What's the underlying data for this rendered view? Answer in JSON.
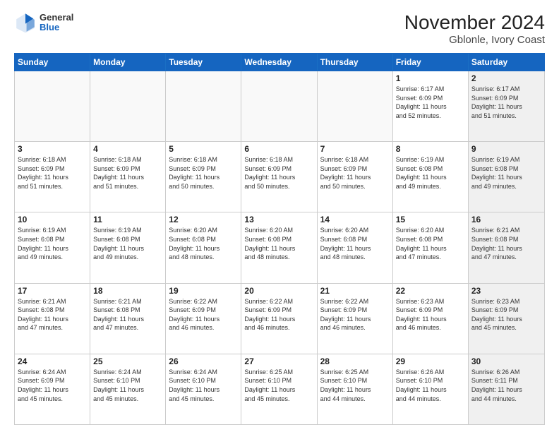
{
  "header": {
    "title": "November 2024",
    "subtitle": "Gblonle, Ivory Coast",
    "logo_general": "General",
    "logo_blue": "Blue"
  },
  "days_of_week": [
    "Sunday",
    "Monday",
    "Tuesday",
    "Wednesday",
    "Thursday",
    "Friday",
    "Saturday"
  ],
  "weeks": [
    [
      {
        "day": "",
        "info": "",
        "shaded": true
      },
      {
        "day": "",
        "info": "",
        "shaded": true
      },
      {
        "day": "",
        "info": "",
        "shaded": true
      },
      {
        "day": "",
        "info": "",
        "shaded": true
      },
      {
        "day": "",
        "info": "",
        "shaded": true
      },
      {
        "day": "1",
        "info": "Sunrise: 6:17 AM\nSunset: 6:09 PM\nDaylight: 11 hours\nand 52 minutes.",
        "shaded": false
      },
      {
        "day": "2",
        "info": "Sunrise: 6:17 AM\nSunset: 6:09 PM\nDaylight: 11 hours\nand 51 minutes.",
        "shaded": true
      }
    ],
    [
      {
        "day": "3",
        "info": "Sunrise: 6:18 AM\nSunset: 6:09 PM\nDaylight: 11 hours\nand 51 minutes.",
        "shaded": false
      },
      {
        "day": "4",
        "info": "Sunrise: 6:18 AM\nSunset: 6:09 PM\nDaylight: 11 hours\nand 51 minutes.",
        "shaded": false
      },
      {
        "day": "5",
        "info": "Sunrise: 6:18 AM\nSunset: 6:09 PM\nDaylight: 11 hours\nand 50 minutes.",
        "shaded": false
      },
      {
        "day": "6",
        "info": "Sunrise: 6:18 AM\nSunset: 6:09 PM\nDaylight: 11 hours\nand 50 minutes.",
        "shaded": false
      },
      {
        "day": "7",
        "info": "Sunrise: 6:18 AM\nSunset: 6:09 PM\nDaylight: 11 hours\nand 50 minutes.",
        "shaded": false
      },
      {
        "day": "8",
        "info": "Sunrise: 6:19 AM\nSunset: 6:08 PM\nDaylight: 11 hours\nand 49 minutes.",
        "shaded": false
      },
      {
        "day": "9",
        "info": "Sunrise: 6:19 AM\nSunset: 6:08 PM\nDaylight: 11 hours\nand 49 minutes.",
        "shaded": true
      }
    ],
    [
      {
        "day": "10",
        "info": "Sunrise: 6:19 AM\nSunset: 6:08 PM\nDaylight: 11 hours\nand 49 minutes.",
        "shaded": false
      },
      {
        "day": "11",
        "info": "Sunrise: 6:19 AM\nSunset: 6:08 PM\nDaylight: 11 hours\nand 49 minutes.",
        "shaded": false
      },
      {
        "day": "12",
        "info": "Sunrise: 6:20 AM\nSunset: 6:08 PM\nDaylight: 11 hours\nand 48 minutes.",
        "shaded": false
      },
      {
        "day": "13",
        "info": "Sunrise: 6:20 AM\nSunset: 6:08 PM\nDaylight: 11 hours\nand 48 minutes.",
        "shaded": false
      },
      {
        "day": "14",
        "info": "Sunrise: 6:20 AM\nSunset: 6:08 PM\nDaylight: 11 hours\nand 48 minutes.",
        "shaded": false
      },
      {
        "day": "15",
        "info": "Sunrise: 6:20 AM\nSunset: 6:08 PM\nDaylight: 11 hours\nand 47 minutes.",
        "shaded": false
      },
      {
        "day": "16",
        "info": "Sunrise: 6:21 AM\nSunset: 6:08 PM\nDaylight: 11 hours\nand 47 minutes.",
        "shaded": true
      }
    ],
    [
      {
        "day": "17",
        "info": "Sunrise: 6:21 AM\nSunset: 6:08 PM\nDaylight: 11 hours\nand 47 minutes.",
        "shaded": false
      },
      {
        "day": "18",
        "info": "Sunrise: 6:21 AM\nSunset: 6:08 PM\nDaylight: 11 hours\nand 47 minutes.",
        "shaded": false
      },
      {
        "day": "19",
        "info": "Sunrise: 6:22 AM\nSunset: 6:09 PM\nDaylight: 11 hours\nand 46 minutes.",
        "shaded": false
      },
      {
        "day": "20",
        "info": "Sunrise: 6:22 AM\nSunset: 6:09 PM\nDaylight: 11 hours\nand 46 minutes.",
        "shaded": false
      },
      {
        "day": "21",
        "info": "Sunrise: 6:22 AM\nSunset: 6:09 PM\nDaylight: 11 hours\nand 46 minutes.",
        "shaded": false
      },
      {
        "day": "22",
        "info": "Sunrise: 6:23 AM\nSunset: 6:09 PM\nDaylight: 11 hours\nand 46 minutes.",
        "shaded": false
      },
      {
        "day": "23",
        "info": "Sunrise: 6:23 AM\nSunset: 6:09 PM\nDaylight: 11 hours\nand 45 minutes.",
        "shaded": true
      }
    ],
    [
      {
        "day": "24",
        "info": "Sunrise: 6:24 AM\nSunset: 6:09 PM\nDaylight: 11 hours\nand 45 minutes.",
        "shaded": false
      },
      {
        "day": "25",
        "info": "Sunrise: 6:24 AM\nSunset: 6:10 PM\nDaylight: 11 hours\nand 45 minutes.",
        "shaded": false
      },
      {
        "day": "26",
        "info": "Sunrise: 6:24 AM\nSunset: 6:10 PM\nDaylight: 11 hours\nand 45 minutes.",
        "shaded": false
      },
      {
        "day": "27",
        "info": "Sunrise: 6:25 AM\nSunset: 6:10 PM\nDaylight: 11 hours\nand 45 minutes.",
        "shaded": false
      },
      {
        "day": "28",
        "info": "Sunrise: 6:25 AM\nSunset: 6:10 PM\nDaylight: 11 hours\nand 44 minutes.",
        "shaded": false
      },
      {
        "day": "29",
        "info": "Sunrise: 6:26 AM\nSunset: 6:10 PM\nDaylight: 11 hours\nand 44 minutes.",
        "shaded": false
      },
      {
        "day": "30",
        "info": "Sunrise: 6:26 AM\nSunset: 6:11 PM\nDaylight: 11 hours\nand 44 minutes.",
        "shaded": true
      }
    ]
  ]
}
